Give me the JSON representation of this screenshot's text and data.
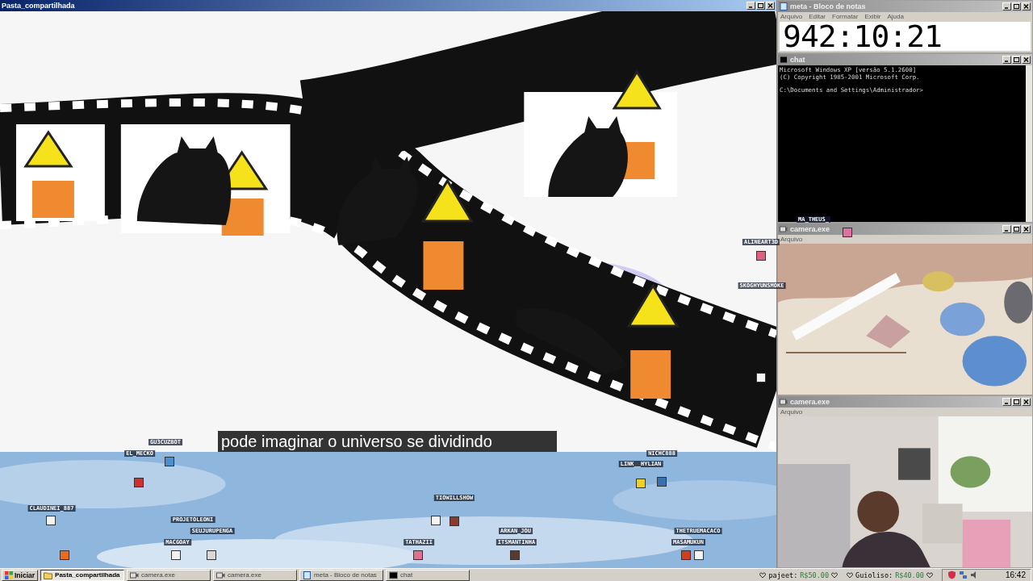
{
  "video_window": {
    "title": "Pasta_compartilhada",
    "subtitle": "pode imaginar o universo se dividindo"
  },
  "notepad": {
    "title": "meta - Bloco de notas",
    "menu": [
      "Arquivo",
      "Editar",
      "Formatar",
      "Exibir",
      "Ajuda"
    ],
    "text": "942:10:21"
  },
  "console": {
    "title": "chat",
    "lines": [
      "Microsoft Windows XP [versão 5.1.2600]",
      "(C) Copyright 1985-2001 Microsoft Corp."
    ],
    "prompt": "C:\\Documents and Settings\\Administrador>"
  },
  "cameras": [
    {
      "title": "camera.exe",
      "menu": [
        "Arquivo"
      ]
    },
    {
      "title": "camera.exe",
      "menu": [
        "Arquivo"
      ]
    }
  ],
  "chat_users": [
    {
      "name": "GU3CUZBOT",
      "color": "#4a8fd0"
    },
    {
      "name": "EL_MECKO",
      "color": "#d03030"
    },
    {
      "name": "CLAUDINEI_887",
      "color": "#f4f4f4"
    },
    {
      "name": "PROJETOLEONI",
      "color": "#d8d8d8"
    },
    {
      "name": "SEUJURUPENGA",
      "color": "#f0f0f0"
    },
    {
      "name": "MACGOAY",
      "color": "#e86a20"
    },
    {
      "name": "TIOWILLSHOW",
      "color": "#f4f4f4"
    },
    {
      "name": "ARKAN_JOU",
      "color": "#8a3a30"
    },
    {
      "name": "TATHAZII",
      "color": "#e07090"
    },
    {
      "name": "ITSMANTINHA",
      "color": "#5a3a30"
    },
    {
      "name": "NICHC888",
      "color": "#3a70b0"
    },
    {
      "name": "LINK__HYLIAN",
      "color": "#f0d020"
    },
    {
      "name": "THETRUEMACACO",
      "color": "#f4f4f4"
    },
    {
      "name": "MASAMUKUN",
      "color": "#d04020"
    },
    {
      "name": "ALINEART3D",
      "color": "#e06080"
    },
    {
      "name": "SKOGHYUNSMOKE",
      "color": "#f4f4f4"
    },
    {
      "name": "MA_THEUS_",
      "color": "#e070a0"
    }
  ],
  "taskbar": {
    "start": "Iniciar",
    "tasks": [
      {
        "label": "Pasta_compartilhada",
        "kind": "folder",
        "selected": true
      },
      {
        "label": "camera.exe",
        "kind": "camera",
        "selected": false
      },
      {
        "label": "camera.exe",
        "kind": "camera",
        "selected": false
      },
      {
        "label": "meta - Bloco de notas",
        "kind": "notepad",
        "selected": false
      },
      {
        "label": "chat",
        "kind": "console",
        "selected": false
      }
    ],
    "donations": [
      {
        "name": "pajeet:",
        "amount": "R$50.00"
      },
      {
        "name": "Guioliso:",
        "amount": "R$40.00"
      }
    ],
    "clock": "16:42"
  }
}
